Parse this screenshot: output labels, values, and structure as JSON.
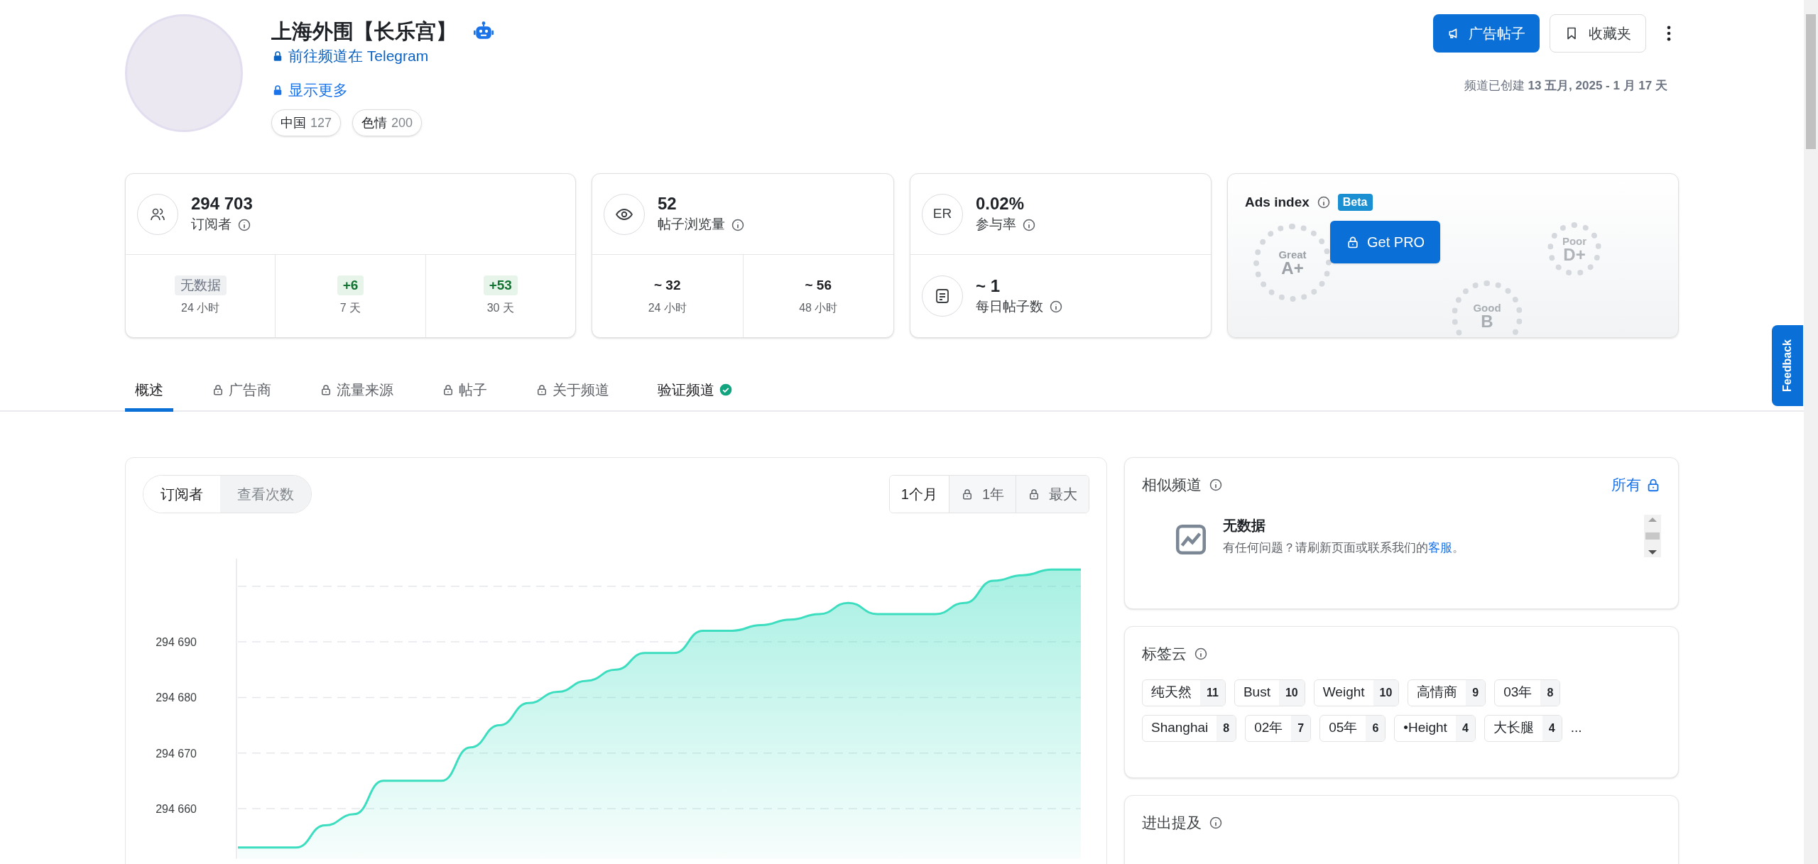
{
  "channel": {
    "title": "上海外围【长乐宫】",
    "telegram_link": "前往频道在 Telegram",
    "show_more": "显示更多",
    "tags": [
      {
        "label": "中国",
        "count": "127"
      },
      {
        "label": "色情",
        "count": "200"
      }
    ]
  },
  "actions": {
    "ad_button": "广告帖子",
    "favorites_button": "收藏夹"
  },
  "created": {
    "label": "频道已创建",
    "date": "13 五月, 2025 - 1 月 17 天"
  },
  "stats": [
    {
      "kind": "split",
      "value": "294 703",
      "label": "订阅者",
      "periods": [
        {
          "value": "无数据",
          "label": "24 小时",
          "kind": "none"
        },
        {
          "value": "+6",
          "label": "7 天",
          "kind": "growth"
        },
        {
          "value": "+53",
          "label": "30 天",
          "kind": "growth"
        }
      ]
    },
    {
      "kind": "split",
      "value": "52",
      "label": "帖子浏览量",
      "periods": [
        {
          "value": "~ 32",
          "label": "24 小时",
          "kind": "plain"
        },
        {
          "value": "~ 56",
          "label": "48 小时",
          "kind": "plain"
        }
      ]
    },
    {
      "kind": "stack",
      "icon_text": "ER",
      "value": "0.02%",
      "label": "参与率",
      "second": {
        "value": "~ 1",
        "label": "每日帖子数"
      }
    }
  ],
  "ads_index": {
    "title": "Ads index",
    "badge": "Beta",
    "button": "Get PRO",
    "grades": [
      {
        "word": "Great",
        "grade": "A+"
      },
      {
        "word": "Poor",
        "grade": "D+"
      },
      {
        "word": "Good",
        "grade": "B"
      }
    ]
  },
  "tabs": [
    {
      "label": "概述",
      "locked": false,
      "selected": true,
      "verified": false
    },
    {
      "label": "广告商",
      "locked": true,
      "selected": false,
      "verified": false
    },
    {
      "label": "流量来源",
      "locked": true,
      "selected": false,
      "verified": false
    },
    {
      "label": "帖子",
      "locked": true,
      "selected": false,
      "verified": false
    },
    {
      "label": "关于频道",
      "locked": true,
      "selected": false,
      "verified": false
    },
    {
      "label": "验证频道",
      "locked": false,
      "selected": false,
      "verified": true
    }
  ],
  "chart_panel": {
    "metrics": [
      {
        "label": "订阅者",
        "selected": true
      },
      {
        "label": "查看次数",
        "selected": false
      }
    ],
    "ranges": [
      {
        "label": "1个月",
        "locked": false,
        "selected": true
      },
      {
        "label": "1年",
        "locked": true,
        "selected": false
      },
      {
        "label": "最大",
        "locked": true,
        "selected": false
      }
    ],
    "chart_data": {
      "type": "area",
      "grid": true,
      "ylim": [
        294651,
        294705
      ],
      "yticks": [
        {
          "value": 294660,
          "label": "294 660"
        },
        {
          "value": 294670,
          "label": "294 670"
        },
        {
          "value": 294680,
          "label": "294 680"
        },
        {
          "value": 294690,
          "label": "294 690"
        }
      ],
      "series": [
        {
          "color": "#3dddc0",
          "values": [
            294653,
            294653,
            294653,
            294657,
            294659,
            294665,
            294665,
            294665,
            294671,
            294675,
            294679,
            294681,
            294683,
            294685,
            294688,
            294688,
            294692,
            294692,
            294693,
            294694,
            294695,
            294697,
            294695,
            294695,
            294695,
            294697,
            294701,
            294702,
            294703,
            294703
          ]
        }
      ]
    }
  },
  "similar": {
    "title": "相似频道",
    "all_link": "所有",
    "empty_title": "无数据",
    "message": "有任何问题？请刷新页面或联系我们的",
    "message_link": "客服",
    "message_end": "。"
  },
  "tag_cloud": {
    "title": "标签云",
    "tags": [
      {
        "label": "纯天然",
        "count": "11"
      },
      {
        "label": "Bust",
        "count": "10"
      },
      {
        "label": "Weight",
        "count": "10"
      },
      {
        "label": "高情商",
        "count": "9"
      },
      {
        "label": "03年",
        "count": "8"
      },
      {
        "label": "Shanghai",
        "count": "8"
      },
      {
        "label": "02年",
        "count": "7"
      },
      {
        "label": "05年",
        "count": "6"
      },
      {
        "label": "•Height",
        "count": "4"
      },
      {
        "label": "大长腿",
        "count": "4"
      }
    ],
    "more": "..."
  },
  "mentions": {
    "title": "进出提及"
  },
  "feedback": "Feedback"
}
